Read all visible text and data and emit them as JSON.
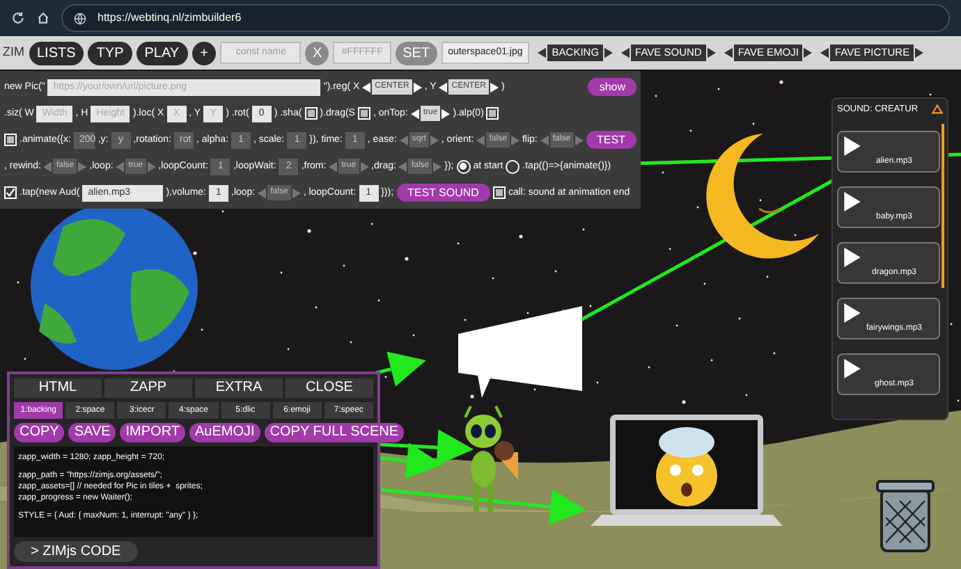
{
  "browser": {
    "url": "https://webtinq.nl/zimbuilder6"
  },
  "toolbar": {
    "label": "ZIM",
    "menu_buttons": [
      "LISTS",
      "TYP",
      "PLAY",
      "+"
    ],
    "name_field": {
      "placeholder": "const name"
    },
    "clear_button": "X",
    "color_field": {
      "placeholder": "#FFFFFF"
    },
    "set_button": "SET",
    "file_field": {
      "value": "outerspace01.jpg"
    },
    "pickers": [
      "BACKING",
      "FAVE SOUND",
      "FAVE EMOJI",
      "FAVE PICTURE"
    ]
  },
  "code_panel": {
    "rows": [
      {
        "tokens": [
          {
            "kind": "text",
            "text": "new Pic(\""
          },
          {
            "kind": "wide_input",
            "placeholder": "https://your/own/url/picture.png"
          },
          {
            "kind": "text",
            "text": "\").reg( X"
          },
          {
            "kind": "stepper",
            "value": "CENTER",
            "disabled": false
          },
          {
            "kind": "text",
            "text": ", Y"
          },
          {
            "kind": "stepper",
            "value": "CENTER",
            "disabled": false
          },
          {
            "kind": "text",
            "text": ")"
          },
          {
            "kind": "spacer"
          },
          {
            "kind": "button",
            "label": "show"
          }
        ]
      },
      {
        "tokens": [
          {
            "kind": "text",
            "text": ".siz( W"
          },
          {
            "kind": "input",
            "placeholder": "Width",
            "disabled": false
          },
          {
            "kind": "text",
            "text": ", H"
          },
          {
            "kind": "input",
            "placeholder": "Height",
            "disabled": false
          },
          {
            "kind": "text",
            "text": ").loc( X"
          },
          {
            "kind": "input",
            "placeholder": "X",
            "disabled": false
          },
          {
            "kind": "text",
            "text": ", Y"
          },
          {
            "kind": "input",
            "placeholder": "Y",
            "disabled": false
          },
          {
            "kind": "text",
            "text": ") .rot("
          },
          {
            "kind": "input",
            "value": "0",
            "disabled": false
          },
          {
            "kind": "text",
            "text": ") .sha("
          },
          {
            "kind": "check",
            "checked": false
          },
          {
            "kind": "text",
            "text": ").drag(S"
          },
          {
            "kind": "check",
            "checked": false
          },
          {
            "kind": "text",
            "text": ", onTop:"
          },
          {
            "kind": "stepper",
            "value": "true",
            "disabled": false
          },
          {
            "kind": "text",
            "text": ").alp(0)"
          },
          {
            "kind": "check",
            "checked": false
          }
        ]
      },
      {
        "tokens": [
          {
            "kind": "check",
            "checked": false
          },
          {
            "kind": "text",
            "text": ".animate({x:"
          },
          {
            "kind": "input",
            "value": "200",
            "disabled": true
          },
          {
            "kind": "text",
            "text": ",y:"
          },
          {
            "kind": "input",
            "value": "y",
            "disabled": true
          },
          {
            "kind": "text",
            "text": ",rotation:"
          },
          {
            "kind": "input",
            "value": "rot",
            "disabled": true
          },
          {
            "kind": "text",
            "text": ", alpha:"
          },
          {
            "kind": "input",
            "value": "1",
            "disabled": true
          },
          {
            "kind": "text",
            "text": ", scale:"
          },
          {
            "kind": "input",
            "value": "1",
            "disabled": true
          },
          {
            "kind": "text",
            "text": "}), time:"
          },
          {
            "kind": "input",
            "value": "1",
            "disabled": true
          },
          {
            "kind": "text",
            "text": ", ease:"
          },
          {
            "kind": "stepper",
            "value": "sqrt",
            "disabled": true
          },
          {
            "kind": "text",
            "text": ", orient:"
          },
          {
            "kind": "stepper",
            "value": "false",
            "disabled": true
          },
          {
            "kind": "text",
            "text": "flip:"
          },
          {
            "kind": "stepper",
            "value": "false",
            "disabled": true
          },
          {
            "kind": "button",
            "label": "TEST"
          }
        ]
      },
      {
        "tokens": [
          {
            "kind": "text",
            "text": ", rewind:"
          },
          {
            "kind": "stepper",
            "value": "false",
            "disabled": true
          },
          {
            "kind": "text",
            "text": ",loop:"
          },
          {
            "kind": "stepper",
            "value": "true",
            "disabled": true
          },
          {
            "kind": "text",
            "text": ",loopCount:"
          },
          {
            "kind": "input",
            "value": "1",
            "disabled": true
          },
          {
            "kind": "text",
            "text": ",loopWait:"
          },
          {
            "kind": "input",
            "value": "2",
            "disabled": true
          },
          {
            "kind": "text",
            "text": ",from:"
          },
          {
            "kind": "stepper",
            "value": "true",
            "disabled": true
          },
          {
            "kind": "text",
            "text": ",drag:"
          },
          {
            "kind": "stepper",
            "value": "false",
            "disabled": true
          },
          {
            "kind": "text",
            "text": "});"
          },
          {
            "kind": "radio",
            "selected": true
          },
          {
            "kind": "text",
            "text": "at start"
          },
          {
            "kind": "radio",
            "selected": false
          },
          {
            "kind": "text",
            "text": ".tap(()=>{animate()})"
          }
        ]
      },
      {
        "tokens": [
          {
            "kind": "check",
            "checked": true
          },
          {
            "kind": "text",
            "text": ".tap(new Aud("
          },
          {
            "kind": "file_input",
            "value": "alien.mp3"
          },
          {
            "kind": "text",
            "text": "),volume:"
          },
          {
            "kind": "input",
            "value": "1",
            "disabled": false
          },
          {
            "kind": "text",
            "text": ",loop:"
          },
          {
            "kind": "stepper",
            "value": "false",
            "disabled": true
          },
          {
            "kind": "text",
            "text": ", loopCount:"
          },
          {
            "kind": "input",
            "value": "1",
            "disabled": false
          },
          {
            "kind": "text",
            "text": "}));"
          },
          {
            "kind": "button",
            "label": "TEST SOUND"
          },
          {
            "kind": "check",
            "checked": false
          },
          {
            "kind": "text",
            "text": "call: sound at animation end"
          }
        ]
      }
    ]
  },
  "sound_panel": {
    "title": "SOUND: CREATUR",
    "items": [
      {
        "label": "alien.mp3"
      },
      {
        "label": "baby.mp3"
      },
      {
        "label": "dragon.mp3"
      },
      {
        "label": "fairywings.mp3"
      },
      {
        "label": "ghost.mp3"
      }
    ]
  },
  "builder_panel": {
    "tabs": [
      "HTML",
      "ZAPP",
      "EXTRA",
      "CLOSE"
    ],
    "scene_tabs": [
      {
        "label": "1:backing",
        "selected": true
      },
      {
        "label": "2:space",
        "selected": false
      },
      {
        "label": "3:icecr",
        "selected": false
      },
      {
        "label": "4:space",
        "selected": false
      },
      {
        "label": "5:dlic",
        "selected": false
      },
      {
        "label": "6:emoji",
        "selected": false
      },
      {
        "label": "7:speec",
        "selected": false
      }
    ],
    "actions": [
      "COPY",
      "SAVE",
      "IMPORT",
      "AuEMOJI",
      "COPY FULL SCENE"
    ],
    "code_blocks": [
      [
        "zapp_width = 1280; zapp_height = 720;"
      ],
      [
        "zapp_path = \"https://zimjs.org/assets/\";",
        "zapp_assets=[] // needed for Pic in tiles +  sprites;",
        "zapp_progress = new Waiter();"
      ],
      [
        "STYLE = { Aud: { maxNum: 1, interrupt: \"any\" } };"
      ]
    ],
    "code_button": "> ZIMjs CODE"
  }
}
